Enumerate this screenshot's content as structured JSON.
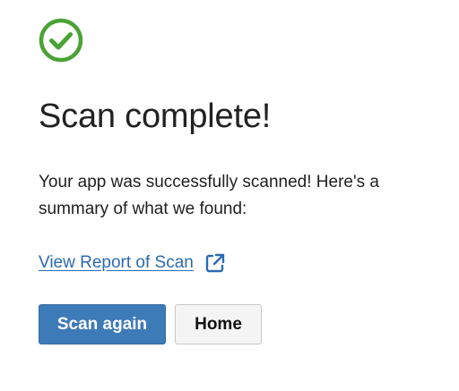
{
  "status": {
    "icon": "check-circle-icon",
    "color": "#4aa335"
  },
  "title": "Scan complete!",
  "summary": "Your app was successfully scanned! Here's a summary of what we found:",
  "report_link": {
    "label": "View Report of Scan",
    "icon": "external-link-icon",
    "color": "#2a6bb0"
  },
  "buttons": {
    "scan_again": "Scan again",
    "home": "Home"
  },
  "colors": {
    "primary_button": "#3d7ab8",
    "secondary_button": "#f4f4f4"
  }
}
